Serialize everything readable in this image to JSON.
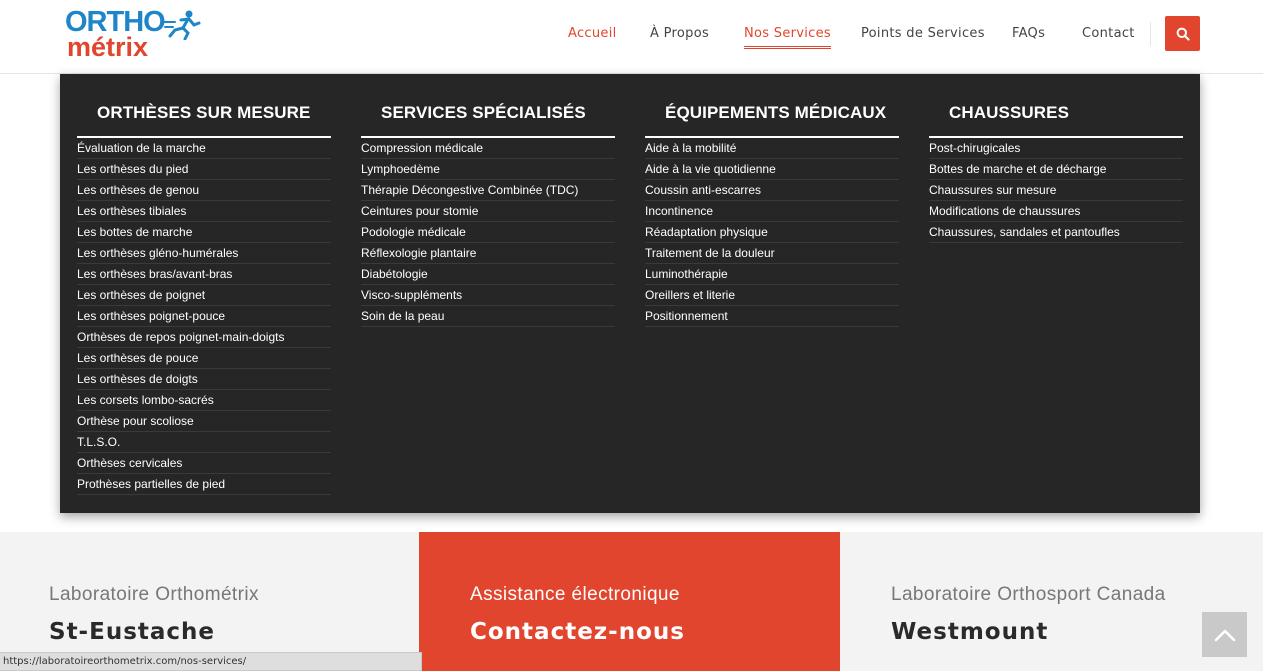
{
  "logo": {
    "top": "ORTHO",
    "bottom": "métrix"
  },
  "nav": {
    "items": [
      {
        "label": "Accueil"
      },
      {
        "label": "À Propos"
      },
      {
        "label": "Nos Services"
      },
      {
        "label": "Points de Services"
      },
      {
        "label": "FAQs"
      },
      {
        "label": "Contact"
      }
    ]
  },
  "icons": {
    "search": "search-icon",
    "to_top": "chevron-up-icon",
    "logo_figure": "runner-icon"
  },
  "colors": {
    "accent": "#e2452e",
    "brand_blue": "#1e86c8",
    "menu_bg": "#262626"
  },
  "mega_menu": {
    "columns": [
      {
        "title": "ORTHÈSES SUR MESURE",
        "items": [
          "Évaluation de la marche",
          "Les orthèses du pied",
          "Les orthèses de genou",
          "Les orthèses tibiales",
          "Les bottes de marche",
          "Les orthèses gléno-humérales",
          "Les orthèses bras/avant-bras",
          "Les orthèses de poignet",
          "Les orthèses poignet-pouce",
          "Orthèses de repos poignet-main-doigts",
          "Les orthèses de pouce",
          "Les orthèses de doigts",
          "Les corsets lombo-sacrés",
          "Orthèse pour scoliose",
          "T.L.S.O.",
          "Orthèses cervicales",
          "Prothèses partielles de pied"
        ]
      },
      {
        "title": "SERVICES SPÉCIALISÉS",
        "items": [
          "Compression médicale",
          "Lymphoedème",
          "Thérapie Décongestive Combinée (TDC)",
          "Ceintures pour stomie",
          "Podologie médicale",
          "Réflexologie plantaire",
          "Diabétologie",
          "Visco-suppléments",
          "Soin de la peau"
        ]
      },
      {
        "title": "ÉQUIPEMENTS MÉDICAUX",
        "items": [
          "Aide à la mobilité",
          "Aide à la vie quotidienne",
          "Coussin anti-escarres",
          "Incontinence",
          "Réadaptation physique",
          "Traitement de la douleur",
          "Luminothérapie",
          "Oreillers et literie",
          "Positionnement"
        ]
      },
      {
        "title": "CHAUSSURES",
        "items": [
          "Post-chirugicales",
          "Bottes de marche et de décharge",
          "Chaussures sur mesure",
          "Modifications de chaussures",
          "Chaussures, sandales et pantoufles"
        ]
      }
    ]
  },
  "panels": [
    {
      "small": "Laboratoire Orthométrix",
      "big": "St-Eustache"
    },
    {
      "small": "Assistance électronique",
      "big": "Contactez-nous"
    },
    {
      "small": "Laboratoire Orthosport Canada",
      "big": "Westmount"
    }
  ],
  "status_bar": {
    "url": "https://laboratoireorthometrix.com/nos-services/"
  }
}
